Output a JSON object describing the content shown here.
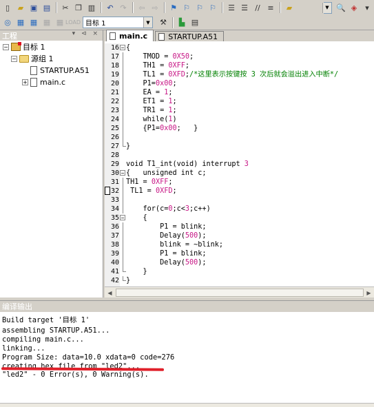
{
  "toolbar1": {
    "icons": [
      "new-file-icon",
      "open-file-icon",
      "save-icon",
      "save-all-icon",
      "cut-icon",
      "copy-icon",
      "paste-icon",
      "undo-icon",
      "redo-icon",
      "nav-back-icon",
      "nav-forward-icon",
      "bookmark-icon",
      "bookmark-prev-icon",
      "bookmark-next-icon",
      "bookmark-clear-icon",
      "indent-icon",
      "unindent-icon",
      "comment-icon",
      "uncomment-icon",
      "find-in-files-icon",
      "search-icon",
      "debug-icon"
    ]
  },
  "toolbar2": {
    "target_select": "目标 1"
  },
  "project_panel": {
    "title": "工程",
    "panel_buttons": "▾ ⊲ ×",
    "tree": {
      "target": "目标 1",
      "group": "源组 1",
      "files": [
        "STARTUP.A51",
        "main.c"
      ]
    }
  },
  "editor": {
    "tabs": [
      {
        "label": "main.c",
        "active": true
      },
      {
        "label": "STARTUP.A51",
        "active": false
      }
    ],
    "lines": [
      {
        "n": "16",
        "fold": "box-minus",
        "code": "{"
      },
      {
        "n": "17",
        "fold": "bar",
        "code": "    TMOD = 0X50;"
      },
      {
        "n": "18",
        "fold": "bar",
        "code": "    TH1 = 0XFF;"
      },
      {
        "n": "19",
        "fold": "bar",
        "code": "    TL1 = 0XFD;",
        "comment": "/*这里表示按键按 3 次后就会溢出进入中断*/"
      },
      {
        "n": "20",
        "fold": "bar",
        "code": "    P1=0x00;"
      },
      {
        "n": "21",
        "fold": "bar",
        "code": "    EA = 1;"
      },
      {
        "n": "22",
        "fold": "bar",
        "code": "    ET1 = 1;"
      },
      {
        "n": "23",
        "fold": "bar",
        "code": "    TR1 = 1;"
      },
      {
        "n": "24",
        "fold": "bar",
        "code": "    while(1)"
      },
      {
        "n": "25",
        "fold": "bar",
        "code": "    {P1=0x00;   }"
      },
      {
        "n": "26",
        "fold": "bar",
        "code": ""
      },
      {
        "n": "27",
        "fold": "end",
        "code": "}"
      },
      {
        "n": "28",
        "fold": "",
        "code": ""
      },
      {
        "n": "29",
        "fold": "",
        "code": "void T1_int(void) interrupt 3"
      },
      {
        "n": "30",
        "fold": "box-minus",
        "code": "{   unsigned int c;"
      },
      {
        "n": "31",
        "fold": "bar",
        "code": "TH1 = 0XFF;"
      },
      {
        "n": "32",
        "fold": "bar",
        "code": " TL1 = 0XFD;",
        "bookmark": true
      },
      {
        "n": "33",
        "fold": "bar",
        "code": ""
      },
      {
        "n": "34",
        "fold": "bar",
        "code": "    for(c=0;c<3;c++)"
      },
      {
        "n": "35",
        "fold": "box-minus",
        "code": "    {"
      },
      {
        "n": "36",
        "fold": "bar",
        "code": "        P1 = blink;"
      },
      {
        "n": "37",
        "fold": "bar",
        "code": "        Delay(500);"
      },
      {
        "n": "38",
        "fold": "bar",
        "code": "        blink = ~blink;"
      },
      {
        "n": "39",
        "fold": "bar",
        "code": "        P1 = blink;"
      },
      {
        "n": "40",
        "fold": "bar",
        "code": "        Delay(500);"
      },
      {
        "n": "41",
        "fold": "end",
        "code": "    }"
      },
      {
        "n": "42",
        "fold": "end",
        "code": "}"
      }
    ]
  },
  "output_panel": {
    "title": "编译输出",
    "lines": [
      "Build target '目标 1'",
      "assembling STARTUP.A51...",
      "compiling main.c...",
      "linking...",
      "Program Size: data=10.0 xdata=0 code=276",
      "creating hex file from \"led2\"...",
      "\"led2\" - 0 Error(s), 0 Warning(s)."
    ],
    "annotation_color": "#e0202a"
  },
  "colors": {
    "chrome": "#d4d0c8",
    "number": "#c71585",
    "comment": "#008000"
  }
}
